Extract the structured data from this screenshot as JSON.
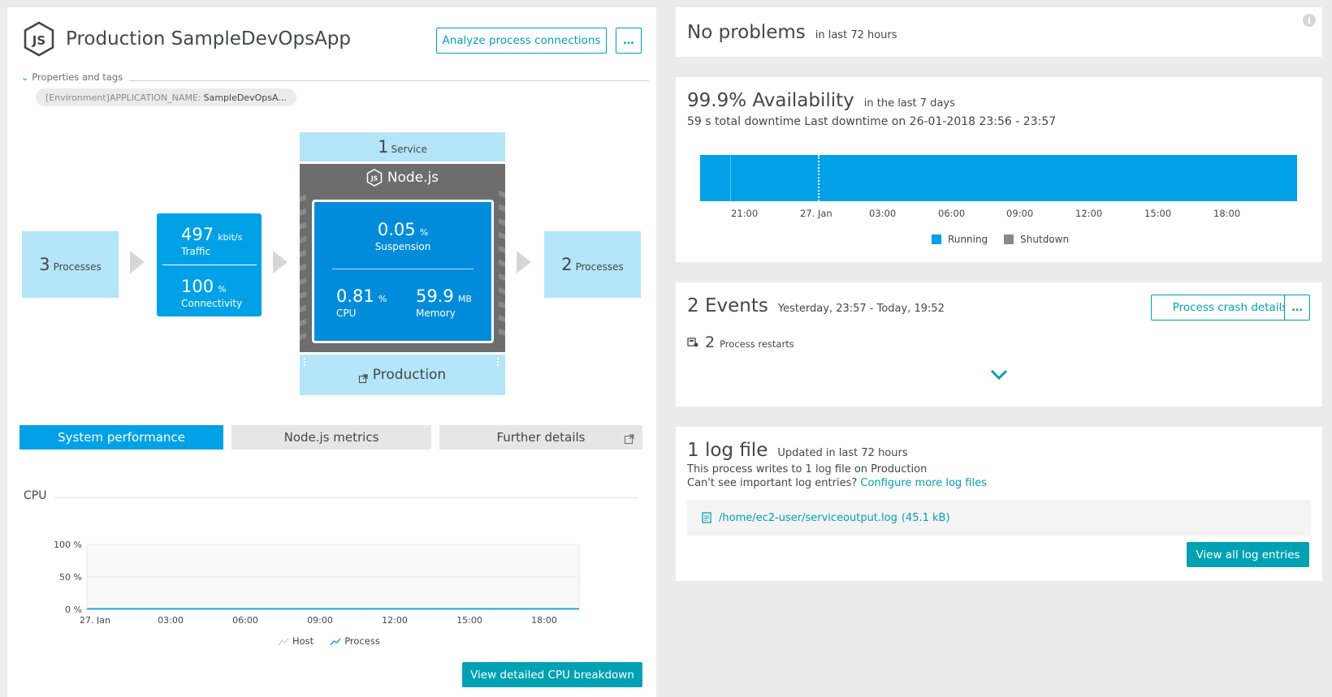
{
  "process": {
    "title": "Production SampleDevOpsApp",
    "analyze_button": "Analyze process connections",
    "more_button": "…",
    "properties_label": "Properties and tags",
    "tag_key": "[Environment]APPLICATION_NAME:",
    "tag_value": "SampleDevOpsA..."
  },
  "flow": {
    "left_count": "3",
    "left_label": "Processes",
    "traffic_value": "497",
    "traffic_unit": "kbit/s",
    "traffic_label": "Traffic",
    "connectivity_value": "100",
    "connectivity_unit": "%",
    "connectivity_label": "Connectivity",
    "service_count": "1",
    "service_label": "Service",
    "tech_label": "Node.js",
    "suspension_value": "0.05",
    "suspension_unit": "%",
    "suspension_label": "Suspension",
    "cpu_value": "0.81",
    "cpu_unit": "%",
    "cpu_label": "CPU",
    "memory_value": "59.9",
    "memory_unit": "MB",
    "memory_label": "Memory",
    "host_label": "Production",
    "right_count": "2",
    "right_label": "Processes"
  },
  "tabs": {
    "system": "System performance",
    "nodejs": "Node.js metrics",
    "further": "Further details"
  },
  "cpu_chart": {
    "heading": "CPU",
    "legend_host": "Host",
    "legend_process": "Process",
    "button": "View detailed CPU breakdown"
  },
  "chart_data": {
    "type": "line",
    "title": "CPU",
    "x": [
      "27. Jan",
      "03:00",
      "06:00",
      "09:00",
      "12:00",
      "15:00",
      "18:00"
    ],
    "series": [
      {
        "name": "Host",
        "values": [
          0,
          0,
          0,
          0,
          0,
          0,
          0
        ]
      },
      {
        "name": "Process",
        "values": [
          0.8,
          0.8,
          0.8,
          0.8,
          0.8,
          0.8,
          0.8
        ]
      }
    ],
    "yticks": [
      "100 %",
      "50 %",
      "0 %"
    ],
    "ylim": [
      0,
      100
    ],
    "grid": true,
    "legend": "bottom",
    "colors": {
      "Host": "#b4b4b4",
      "Process": "#00a1e6"
    }
  },
  "problems": {
    "title": "No problems",
    "subtitle": "in last 72 hours",
    "info_icon": "info-icon"
  },
  "availability": {
    "title": "99.9% Availability",
    "subtitle": "in the last 7 days",
    "downtime": "59 s total downtime Last downtime on 26-01-2018 23:56 - 23:57",
    "xticks": [
      "21:00",
      "27. Jan",
      "03:00",
      "06:00",
      "09:00",
      "12:00",
      "15:00",
      "18:00"
    ],
    "legend_running": "Running",
    "legend_shutdown": "Shutdown",
    "running_color": "#00a1e6",
    "shutdown_color": "#898989"
  },
  "events": {
    "title": "2 Events",
    "subtitle": "Yesterday, 23:57 - Today, 19:52",
    "crash_button": "Process crash details",
    "more_button": "…",
    "restart_count": "2",
    "restart_label": "Process restarts"
  },
  "logs": {
    "title": "1 log file",
    "subtitle": "Updated in last 72 hours",
    "line1": "This process writes to 1 log file on Production",
    "line2_prefix": "Can't see important log entries?",
    "configure_link": "Configure more log files",
    "file_link": "/home/ec2-user/serviceoutput.log",
    "file_size": "(45.1 kB)",
    "view_button": "View all log entries"
  },
  "colors": {
    "accent": "#00a1b2",
    "blue": "#00a1e6",
    "light_blue": "#b4e5f9",
    "dark_blue": "#008cdb",
    "gray_frame": "#6d6d6d"
  }
}
